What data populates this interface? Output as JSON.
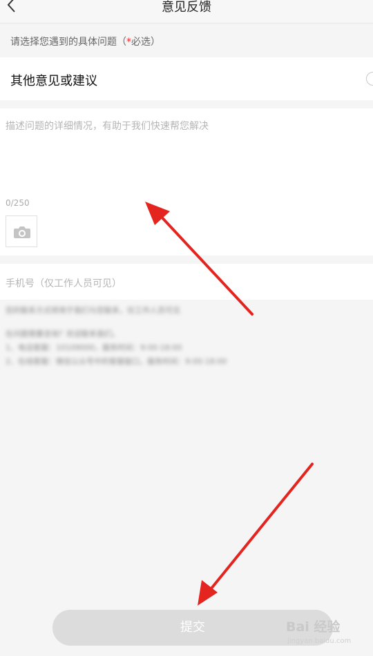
{
  "header": {
    "back_icon": "chevron-left-icon",
    "title": "意见反馈"
  },
  "hint": {
    "text_before": "请选择您遇到的具体问题（",
    "star": "*",
    "text_after": "必选）"
  },
  "option": {
    "label": "其他意见或建议",
    "selected": false
  },
  "description": {
    "placeholder": "描述问题的详细情况，有助于我们快速帮您解决",
    "counter": "0/250",
    "photo_icon": "camera-icon"
  },
  "phone": {
    "placeholder": "手机号（仅工作人员可见）"
  },
  "info": {
    "line1": "您的联系方式将用于我们与您联系，仅工作人员可见",
    "line2": "在问题需要咨询？欢迎联系我们。",
    "line3": "1、电话客服：10109000，服务时间：9:00-18:00",
    "line4": "2、在线客服：微信公众号中的客服窗口，服务时间：9:00-18:00"
  },
  "submit": {
    "label": "提交"
  },
  "watermark": {
    "main": "Bai 经验",
    "sub": "jingyan.baidu.com"
  },
  "colors": {
    "accent_required": "#e62b2b",
    "annotation_arrow": "#e3241f",
    "submit_disabled": "#dcdcdc"
  }
}
